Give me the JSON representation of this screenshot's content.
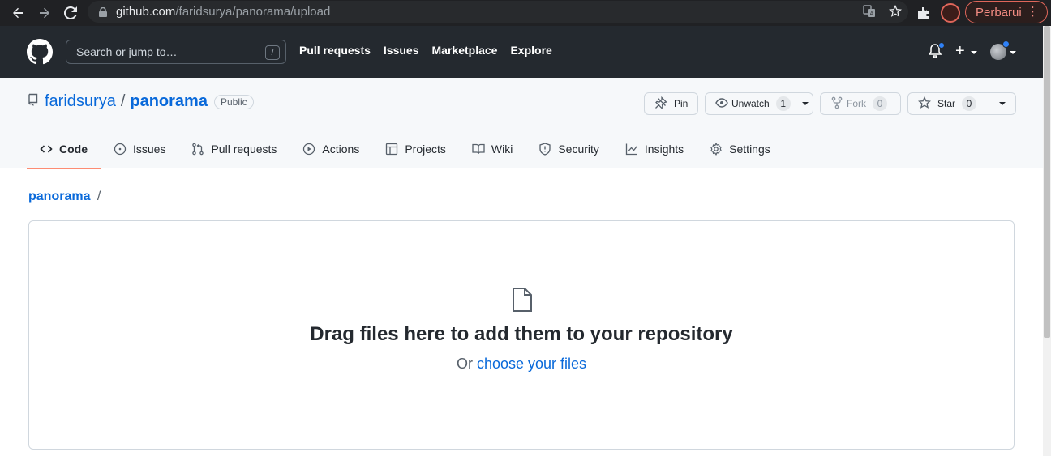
{
  "browser": {
    "url_host": "github.com",
    "url_path": "/faridsurya/panorama/upload",
    "update_label": "Perbarui",
    "update_menu_glyph": "⋮",
    "icons": [
      "back-icon",
      "forward-icon",
      "reload-icon",
      "lock-icon",
      "translate-icon",
      "bookmark-star-icon",
      "extensions-icon",
      "profile-avatar-icon"
    ]
  },
  "header": {
    "search_placeholder": "Search or jump to…",
    "search_shortcut": "/",
    "nav": [
      "Pull requests",
      "Issues",
      "Marketplace",
      "Explore"
    ],
    "plus_label": "+"
  },
  "repo": {
    "owner": "faridsurya",
    "separator": "/",
    "name": "panorama",
    "visibility": "Public",
    "pin_label": "Pin",
    "unwatch_label": "Unwatch",
    "watch_count": "1",
    "fork_label": "Fork",
    "fork_count": "0",
    "star_label": "Star",
    "star_count": "0"
  },
  "tabs": [
    {
      "label": "Code",
      "icon": "code-icon",
      "selected": true
    },
    {
      "label": "Issues",
      "icon": "issue-icon"
    },
    {
      "label": "Pull requests",
      "icon": "pull-request-icon"
    },
    {
      "label": "Actions",
      "icon": "play-icon"
    },
    {
      "label": "Projects",
      "icon": "table-icon"
    },
    {
      "label": "Wiki",
      "icon": "book-icon"
    },
    {
      "label": "Security",
      "icon": "shield-icon"
    },
    {
      "label": "Insights",
      "icon": "graph-icon"
    },
    {
      "label": "Settings",
      "icon": "gear-icon"
    }
  ],
  "breadcrumb": {
    "repo": "panorama",
    "slash": "/"
  },
  "dropzone": {
    "title": "Drag files here to add them to your repository",
    "or_text": "Or ",
    "choose_link": "choose your files"
  },
  "colors": {
    "header_bg": "#24292f",
    "link": "#0969da",
    "tab_underline": "#fd8c73",
    "repo_head_bg": "#f6f8fa"
  }
}
